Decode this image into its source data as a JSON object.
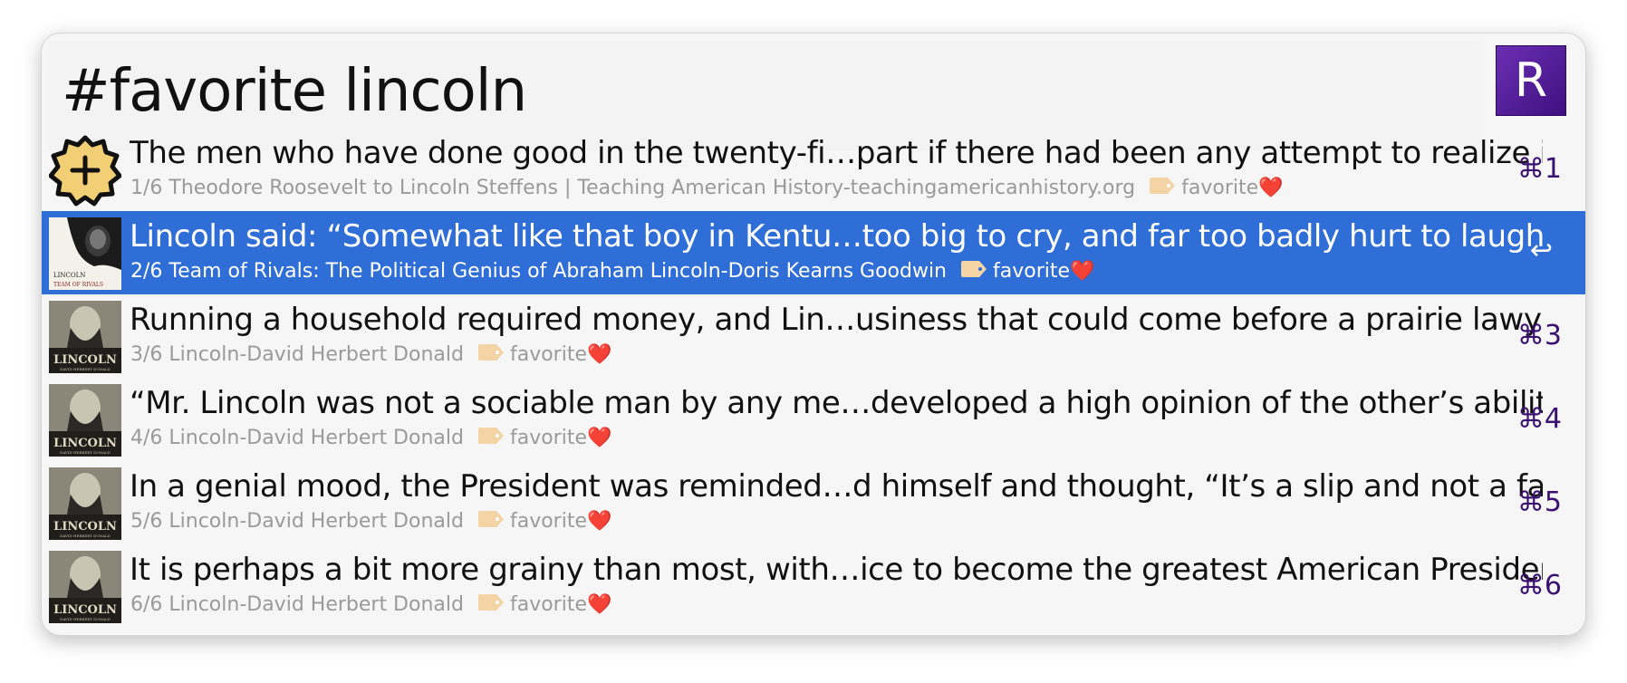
{
  "search": {
    "query": "#favorite lincoln"
  },
  "app_badge": {
    "letter": "R",
    "color": "#4b1491"
  },
  "colors": {
    "selection": "#2f6ed6",
    "shortcut": "#3a1170",
    "heart": "#e0262a"
  },
  "results": [
    {
      "title": "The men who have done good in the twenty-fi…part if there had been any attempt to realize it.",
      "subtitle": "1/6 Theodore Roosevelt to Lincoln Steffens | Teaching American History-teachingamericanhistory.org",
      "tag": "favorite",
      "heart": "❤️",
      "shortcut": "⌘1",
      "thumb": "gear-plus-icon"
    },
    {
      "title": "Lincoln said: “Somewhat like that boy in Kentu…too big to cry, and far too badly hurt to laugh.”",
      "subtitle": "2/6 Team of Rivals: The Political Genius of Abraham Lincoln-Doris Kearns Goodwin",
      "tag": "favorite",
      "heart": "❤️",
      "shortcut": "↩",
      "thumb": "team-of-rivals-cover",
      "cover_text": "LINCOLN",
      "cover_subtext": "TEAM OF RIVALS",
      "selected": true
    },
    {
      "title": "Running a household required money, and Lin…usiness that could come before a prairie lawyer.",
      "subtitle": "3/6 Lincoln-David Herbert Donald",
      "tag": "favorite",
      "heart": "❤️",
      "shortcut": "⌘3",
      "thumb": "lincoln-book-cover",
      "cover_text": "LINCOLN",
      "cover_subtext": "DAVID HERBERT DONALD"
    },
    {
      "title": "“Mr. Lincoln was not a sociable man by any me…developed a high opinion of the other’s ability.",
      "subtitle": "4/6 Lincoln-David Herbert Donald",
      "tag": "favorite",
      "heart": "❤️",
      "shortcut": "⌘4",
      "thumb": "lincoln-book-cover",
      "cover_text": "LINCOLN",
      "cover_subtext": "DAVID HERBERT DONALD"
    },
    {
      "title": "In a genial mood, the President was reminded…d himself and thought, “It’s a slip and not a fall.”",
      "subtitle": "5/6 Lincoln-David Herbert Donald",
      "tag": "favorite",
      "heart": "❤️",
      "shortcut": "⌘5",
      "thumb": "lincoln-book-cover",
      "cover_text": "LINCOLN",
      "cover_subtext": "DAVID HERBERT DONALD"
    },
    {
      "title": "It is perhaps a bit more grainy than most, with…ice to become the greatest American President.",
      "subtitle": "6/6 Lincoln-David Herbert Donald",
      "tag": "favorite",
      "heart": "❤️",
      "shortcut": "⌘6",
      "thumb": "lincoln-book-cover",
      "cover_text": "LINCOLN",
      "cover_subtext": "DAVID HERBERT DONALD"
    }
  ]
}
